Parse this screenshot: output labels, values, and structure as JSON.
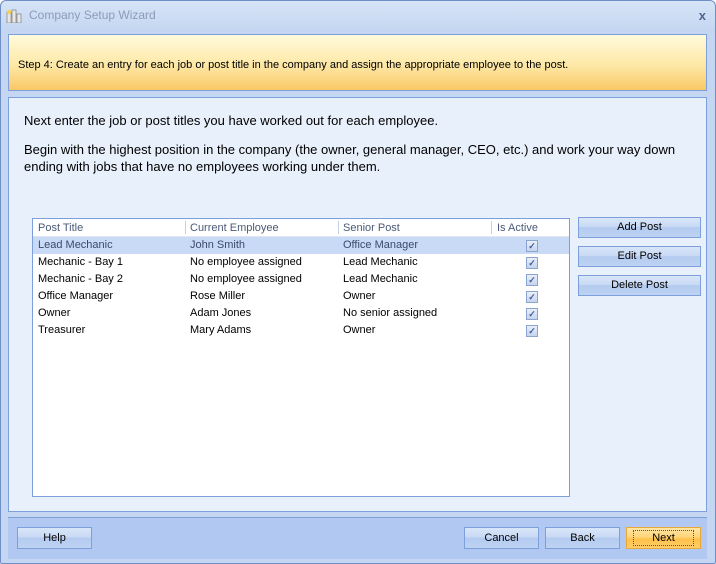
{
  "window": {
    "title": "Company Setup Wizard",
    "close_glyph": "x"
  },
  "banner": {
    "text": "Step 4: Create an entry for each job or post title in the company and assign the appropriate employee to the post."
  },
  "intro": {
    "line1": "Next enter the job or post titles you have worked out for each employee.",
    "line2": "Begin with the highest position in the company (the owner, general manager, CEO, etc.) and work your way down ending with jobs that have no employees working under them."
  },
  "table": {
    "columns": [
      "Post Title",
      "Current Employee",
      "Senior Post",
      "Is Active"
    ],
    "rows": [
      {
        "post_title": "Lead Mechanic",
        "current_employee": "John Smith",
        "senior_post": "Office Manager",
        "is_active": "✓",
        "selected": true
      },
      {
        "post_title": "Mechanic - Bay 1",
        "current_employee": "No employee assigned",
        "senior_post": "Lead Mechanic",
        "is_active": "✓",
        "selected": false
      },
      {
        "post_title": "Mechanic - Bay 2",
        "current_employee": "No employee assigned",
        "senior_post": "Lead Mechanic",
        "is_active": "✓",
        "selected": false
      },
      {
        "post_title": "Office Manager",
        "current_employee": "Rose Miller",
        "senior_post": "Owner",
        "is_active": "✓",
        "selected": false
      },
      {
        "post_title": "Owner",
        "current_employee": "Adam Jones",
        "senior_post": "No senior assigned",
        "is_active": "✓",
        "selected": false
      },
      {
        "post_title": "Treasurer",
        "current_employee": "Mary Adams",
        "senior_post": "Owner",
        "is_active": "✓",
        "selected": false
      }
    ]
  },
  "side_buttons": {
    "add": "Add Post",
    "edit": "Edit Post",
    "delete": "Delete Post"
  },
  "footer": {
    "help": "Help",
    "cancel": "Cancel",
    "back": "Back",
    "next": "Next"
  },
  "colors": {
    "accent_blue": "#7d9fda",
    "banner_orange": "#f9c865",
    "selected_row": "#c8daf5",
    "primary_button": "#ffc24a"
  }
}
